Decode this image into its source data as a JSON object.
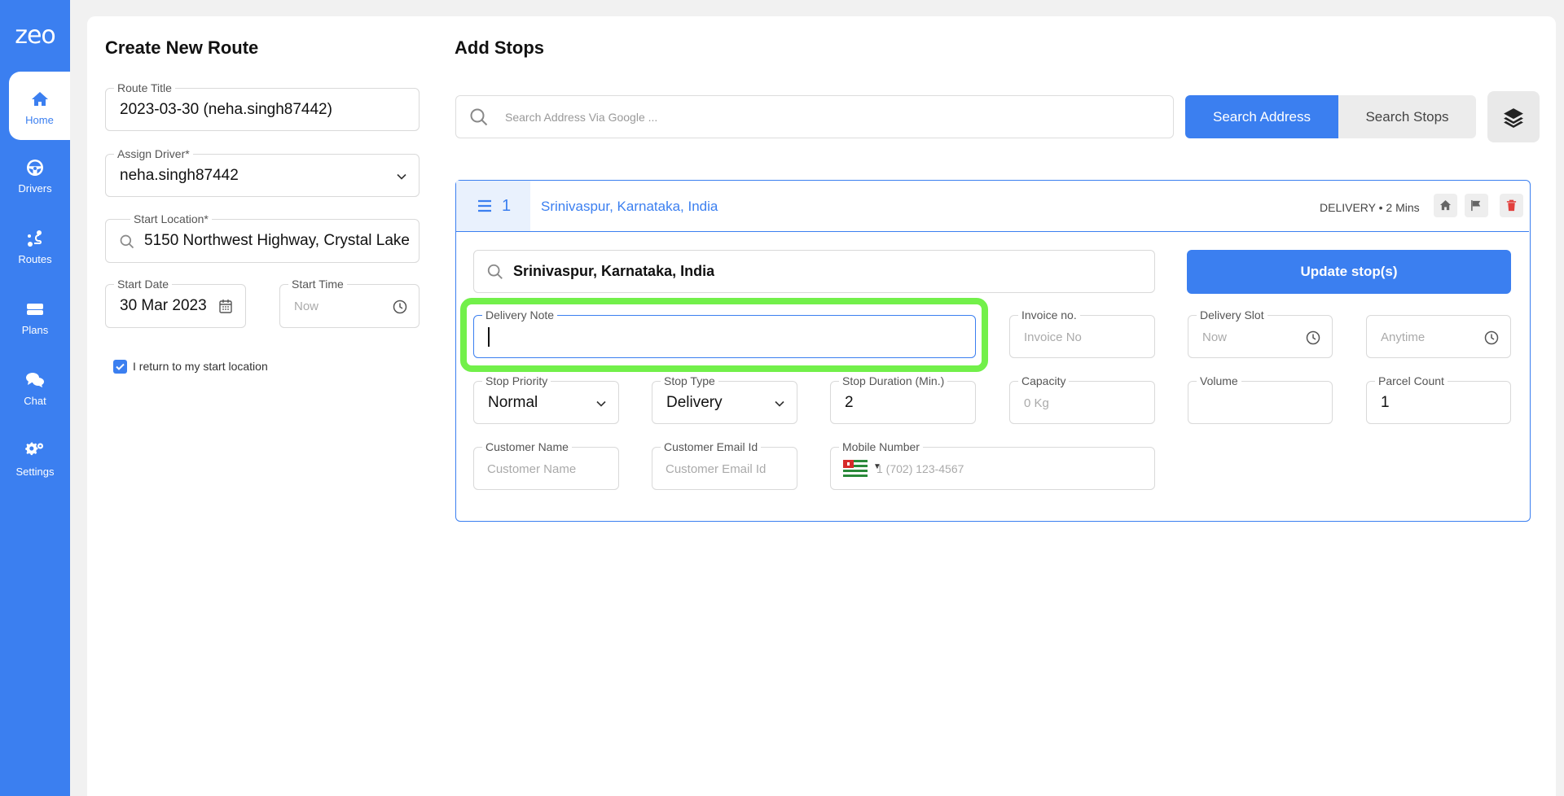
{
  "sidebar": {
    "logo": "zeo",
    "items": [
      {
        "label": "Home",
        "icon": "home-icon"
      },
      {
        "label": "Drivers",
        "icon": "steering-wheel-icon"
      },
      {
        "label": "Routes",
        "icon": "route-icon"
      },
      {
        "label": "Plans",
        "icon": "plans-icon"
      },
      {
        "label": "Chat",
        "icon": "chat-icon"
      },
      {
        "label": "Settings",
        "icon": "gears-icon"
      }
    ],
    "active": "Home",
    "color": "#3b7ff0"
  },
  "create_route": {
    "title": "Create New Route",
    "route_title": {
      "label": "Route Title",
      "value": "2023-03-30 (neha.singh87442)"
    },
    "assign_driver": {
      "label": "Assign Driver*",
      "value": "neha.singh87442"
    },
    "start_location": {
      "label": "Start Location*",
      "value": "5150 Northwest Highway, Crystal Lake"
    },
    "start_date": {
      "label": "Start Date",
      "value": "30 Mar 2023"
    },
    "start_time": {
      "label": "Start Time",
      "placeholder": "Now"
    },
    "return_checkbox": {
      "label": "I return to my start location",
      "checked": true
    }
  },
  "add_stops": {
    "title": "Add Stops",
    "search_placeholder": "Search Address Via Google ...",
    "search_address_label": "Search Address",
    "search_stops_label": "Search Stops"
  },
  "stop": {
    "number": "1",
    "address": "Srinivaspur, Karnataka, India",
    "meta": "DELIVERY • 2 Mins",
    "address_value": "Srinivaspur, Karnataka, India",
    "update_label": "Update stop(s)",
    "delivery_note": {
      "label": "Delivery Note",
      "value": ""
    },
    "invoice": {
      "label": "Invoice no.",
      "placeholder": "Invoice No"
    },
    "delivery_slot": {
      "label": "Delivery Slot",
      "placeholder": "Now"
    },
    "delivery_slot_end": {
      "placeholder": "Anytime"
    },
    "stop_priority": {
      "label": "Stop Priority",
      "value": "Normal"
    },
    "stop_type": {
      "label": "Stop Type",
      "value": "Delivery"
    },
    "stop_duration": {
      "label": "Stop Duration (Min.)",
      "value": "2"
    },
    "capacity": {
      "label": "Capacity",
      "placeholder": "0 Kg"
    },
    "volume": {
      "label": "Volume",
      "value": ""
    },
    "parcel_count": {
      "label": "Parcel Count",
      "value": "1"
    },
    "customer_name": {
      "label": "Customer Name",
      "placeholder": "Customer Name"
    },
    "customer_email": {
      "label": "Customer Email Id",
      "placeholder": "Customer Email Id"
    },
    "mobile": {
      "label": "Mobile Number",
      "placeholder": "1 (702) 123-4567"
    }
  },
  "highlight_color": "#72f04a"
}
